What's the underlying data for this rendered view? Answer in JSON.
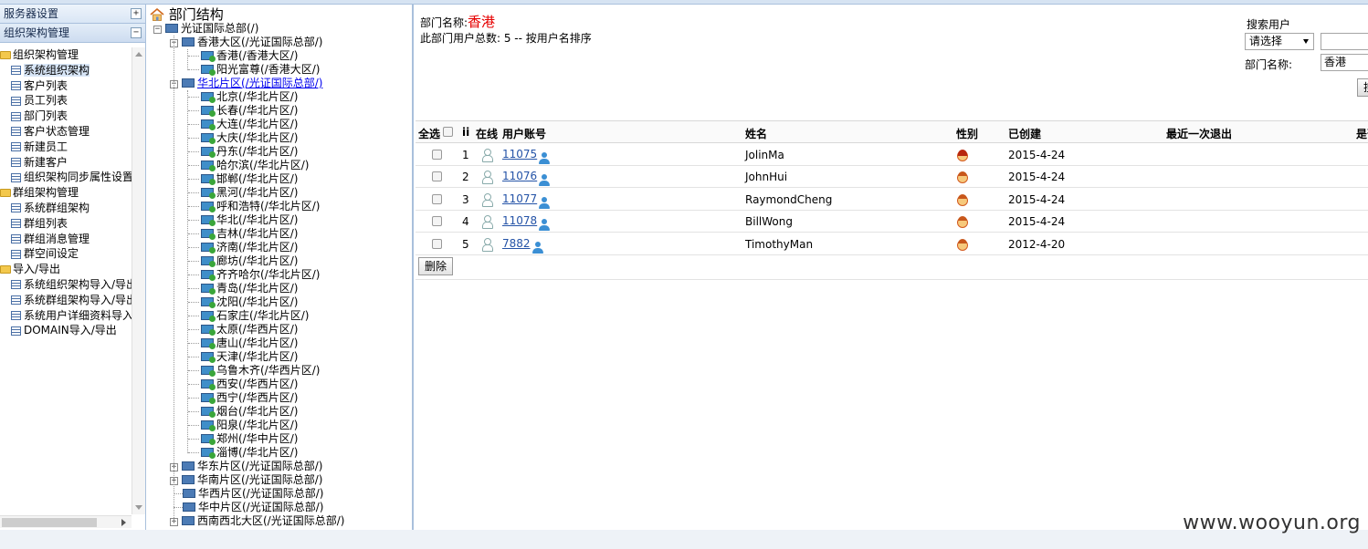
{
  "menu": {
    "server_settings": "服务器设置",
    "org_management": "组织架构管理",
    "items": [
      {
        "type": "folder",
        "label": "组织架构管理"
      },
      {
        "type": "item",
        "label": "系统组织架构"
      },
      {
        "type": "item",
        "label": "客户列表"
      },
      {
        "type": "item",
        "label": "员工列表"
      },
      {
        "type": "item",
        "label": "部门列表"
      },
      {
        "type": "item",
        "label": "客户状态管理"
      },
      {
        "type": "item",
        "label": "新建员工"
      },
      {
        "type": "item",
        "label": "新建客户"
      },
      {
        "type": "item",
        "label": "组织架构同步属性设置"
      },
      {
        "type": "folder",
        "label": "群组架构管理"
      },
      {
        "type": "item",
        "label": "系统群组架构"
      },
      {
        "type": "item",
        "label": "群组列表"
      },
      {
        "type": "item",
        "label": "群组消息管理"
      },
      {
        "type": "item",
        "label": "群空间设定"
      },
      {
        "type": "folder",
        "label": "导入/导出"
      },
      {
        "type": "item",
        "label": "系统组织架构导入/导出"
      },
      {
        "type": "item",
        "label": "系统群组架构导入/导出"
      },
      {
        "type": "item",
        "label": "系统用户详细资料导入"
      },
      {
        "type": "item",
        "label": "DOMAIN导入/导出"
      }
    ]
  },
  "tree": {
    "title": "部门结构",
    "root": "光证国际总部(/)",
    "hk_region": "香港大区(/光证国际总部/)",
    "hk_children": [
      "香港(/香港大区/)",
      "阳光富尊(/香港大区/)"
    ],
    "north_region": "华北片区(/光证国际总部/)",
    "north_children": [
      "北京(/华北片区/)",
      "长春(/华北片区/)",
      "大连(/华北片区/)",
      "大庆(/华北片区/)",
      "丹东(/华北片区/)",
      "哈尔滨(/华北片区/)",
      "邯郸(/华北片区/)",
      "黑河(/华北片区/)",
      "呼和浩特(/华北片区/)",
      "华北(/华北片区/)",
      "吉林(/华北片区/)",
      "济南(/华北片区/)",
      "廊坊(/华北片区/)",
      "齐齐哈尔(/华北片区/)",
      "青岛(/华北片区/)",
      "沈阳(/华北片区/)",
      "石家庄(/华北片区/)",
      "太原(/华西片区/)",
      "唐山(/华北片区/)",
      "天津(/华北片区/)",
      "乌鲁木齐(/华西片区/)",
      "西安(/华西片区/)",
      "西宁(/华西片区/)",
      "烟台(/华北片区/)",
      "阳泉(/华北片区/)",
      "郑州(/华中片区/)",
      "淄博(/华北片区/)"
    ],
    "other_regions": [
      {
        "label": "华东片区(/光证国际总部/)",
        "expandable": true
      },
      {
        "label": "华南片区(/光证国际总部/)",
        "expandable": true
      },
      {
        "label": "华西片区(/光证国际总部/)",
        "expandable": false
      },
      {
        "label": "华中片区(/光证国际总部/)",
        "expandable": false
      },
      {
        "label": "西南西北大区(/光证国际总部/)",
        "expandable": true
      }
    ]
  },
  "dept": {
    "name_label": "部门名称:",
    "name_value": "香港",
    "count_text": "此部门用户总数: 5 -- 按用户名排序"
  },
  "search": {
    "label": "搜索用户",
    "select_value": "请选择",
    "dept_label": "部门名称:",
    "dept_value": "香港",
    "button_label": "搜索"
  },
  "table": {
    "headers": {
      "select_all": "全选",
      "id": "ii",
      "online": "在线",
      "account": "用户账号",
      "name": "姓名",
      "gender": "性别",
      "created": "已创建",
      "last_exit": "最近一次退出",
      "more": "是否"
    },
    "rows": [
      {
        "index": "1",
        "account": "11075",
        "name": "JolinMa",
        "gender": "female",
        "created": "2015-4-24",
        "last_exit": ""
      },
      {
        "index": "2",
        "account": "11076",
        "name": "JohnHui",
        "gender": "male",
        "created": "2015-4-24",
        "last_exit": ""
      },
      {
        "index": "3",
        "account": "11077",
        "name": "RaymondCheng",
        "gender": "male",
        "created": "2015-4-24",
        "last_exit": ""
      },
      {
        "index": "4",
        "account": "11078",
        "name": "BillWong",
        "gender": "male",
        "created": "2015-4-24",
        "last_exit": ""
      },
      {
        "index": "5",
        "account": "7882",
        "name": "TimothyMan",
        "gender": "male",
        "created": "2012-4-20",
        "last_exit": ""
      }
    ],
    "delete_label": "删除"
  },
  "watermark": "www.wooyun.org"
}
